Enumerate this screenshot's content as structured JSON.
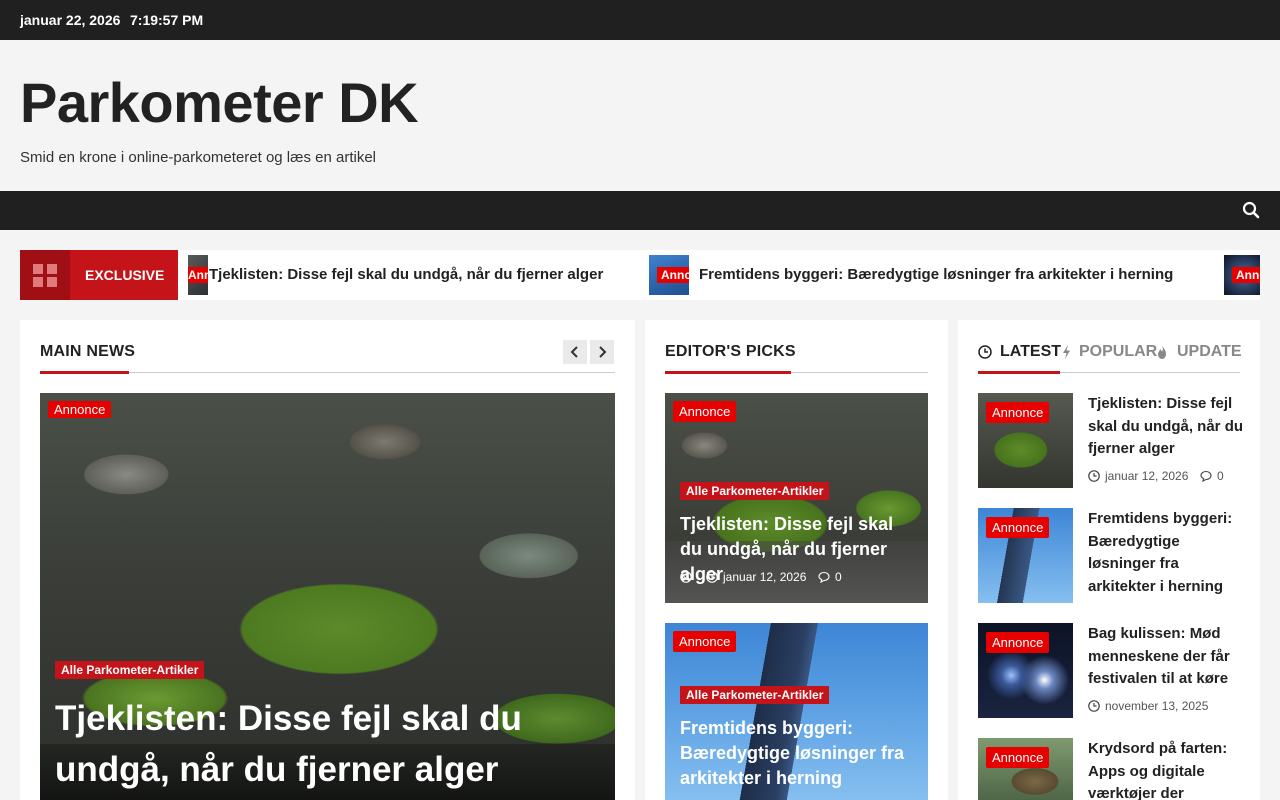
{
  "topbar": {
    "date": "januar 22, 2026",
    "time": "7:19:57 PM"
  },
  "site": {
    "title": "Parkometer DK",
    "tagline": "Smid en krone i online-parkometeret og læs en artikel"
  },
  "ticker": {
    "label": "EXCLUSIVE",
    "badge": "Annonce",
    "items": [
      {
        "title": "Tjeklisten: Disse fejl skal du undgå, når du fjerner alger"
      },
      {
        "title": "Fremtidens byggeri: Bæredygtige løsninger fra arkitekter i herning"
      }
    ]
  },
  "main_news": {
    "heading": "MAIN NEWS",
    "badge": "Annonce",
    "category": "Alle Parkometer-Artikler",
    "title": "Tjeklisten: Disse fejl skal du undgå, når du fjerner alger"
  },
  "editors_picks": {
    "heading": "EDITOR'S PICKS",
    "items": [
      {
        "badge": "Annonce",
        "category": "Alle Parkometer-Artikler",
        "title": "Tjeklisten: Disse fejl skal du undgå, når du fjerner alger",
        "date": "januar 12, 2026",
        "comments": "0"
      },
      {
        "badge": "Annonce",
        "category": "Alle Parkometer-Artikler",
        "title": "Fremtidens byggeri: Bæredygtige løsninger fra arkitekter i herning"
      }
    ]
  },
  "tabs": {
    "latest": "LATEST",
    "popular": "POPULAR",
    "update": "UPDATE"
  },
  "latest_list": [
    {
      "badge": "Annonce",
      "title": "Tjeklisten: Disse fejl skal du undgå, når du fjerner alger",
      "date": "januar 12, 2026",
      "comments": "0"
    },
    {
      "badge": "Annonce",
      "title": "Fremtidens byggeri: Bæredygtige løsninger fra arkitekter i herning"
    },
    {
      "badge": "Annonce",
      "title": "Bag kulissen: Mød menneskene der får festivalen til at køre",
      "date": "november 13, 2025"
    },
    {
      "badge": "Annonce",
      "title": "Krydsord på farten: Apps og digitale værktøjer der"
    }
  ],
  "colors": {
    "accent": "#c4141a",
    "badge": "#e60000",
    "dark": "#202020"
  }
}
